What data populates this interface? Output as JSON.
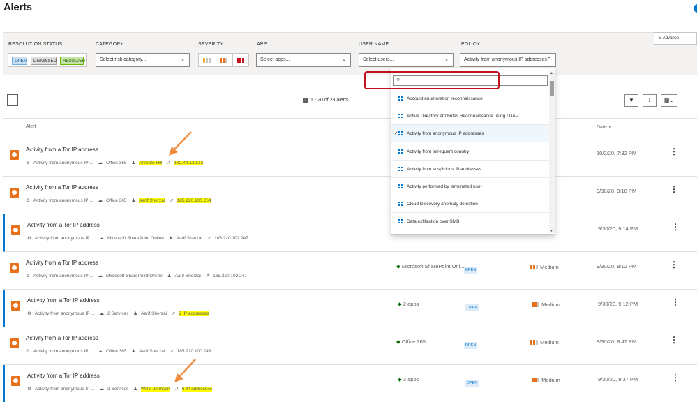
{
  "page": {
    "title": "Alerts"
  },
  "filters": {
    "resolution_status": {
      "label": "RESOLUTION STATUS",
      "chips": [
        "OPEN",
        "DISMISSED",
        "RESOLVED"
      ]
    },
    "category": {
      "label": "CATEGORY",
      "placeholder": "Select risk category..."
    },
    "severity": {
      "label": "SEVERITY"
    },
    "app": {
      "label": "APP",
      "placeholder": "Select apps..."
    },
    "user_name": {
      "label": "USER NAME",
      "placeholder": "Select users..."
    },
    "policy": {
      "label": "POLICY",
      "value": "Activity from anonymous IP addresses"
    },
    "advanced": "∨ Advance"
  },
  "toolbar": {
    "count": "1 - 20 of 28 alerts"
  },
  "table": {
    "headers": {
      "alert": "Alert",
      "date": "Date ∨"
    },
    "rows": [
      {
        "title": "Activity from a Tor IP address",
        "policy": "Activity from anonymous IP ...",
        "app": "Office 365",
        "user": "Annette Hill",
        "ip": "142.44.139.12",
        "app_col": "",
        "status": "",
        "severity": "dium",
        "date": "10/2/20, 7:32 PM"
      },
      {
        "title": "Activity from a Tor IP address",
        "policy": "Activity from anonymous IP ...",
        "app": "Office 365",
        "user": "Aarif Sherzai",
        "ip": "185.220.100.254",
        "app_col": "",
        "status": "",
        "severity": "m",
        "date": "9/30/20, 9:18 PM"
      },
      {
        "title": "Activity from a Tor IP address",
        "policy": "Activity from anonymous IP ...",
        "app": "Microsoft SharePoint Online",
        "user": "Aarif Sherzai",
        "ip": "185.220.102.247",
        "app_col": "",
        "status": "",
        "severity": "m",
        "date": "9/30/20, 9:14 PM"
      },
      {
        "title": "Activity from a Tor IP address",
        "policy": "Activity from anonymous IP ...",
        "app": "Microsoft SharePoint Online",
        "user": "Aarif Sherzai",
        "ip": "185.220.102.247",
        "app_col": "Microsoft SharePoint Onl...",
        "status": "OPEN",
        "severity": "Medium",
        "date": "9/30/20, 9:12 PM"
      },
      {
        "title": "Activity from a Tor IP address",
        "policy": "Activity from anonymous IP ...",
        "app": "2 Services",
        "user": "Aarif Sherzai",
        "ip": "2 IP addresses",
        "app_col": "2 apps",
        "status": "OPEN",
        "severity": "Medium",
        "date": "9/30/20, 9:12 PM"
      },
      {
        "title": "Activity from a Tor IP address",
        "policy": "Activity from anonymous IP ...",
        "app": "Office 365",
        "user": "Aarif Sherzai",
        "ip": "185.220.100.248",
        "app_col": "Office 365",
        "status": "OPEN",
        "severity": "Medium",
        "date": "9/30/20, 8:47 PM"
      },
      {
        "title": "Activity from a Tor IP address",
        "policy": "Activity from anonymous IP ...",
        "app": "3 Services",
        "user": "Willis Johnson",
        "ip": "6 IP addresses",
        "app_col": "3 apps",
        "status": "OPEN",
        "severity": "Medium",
        "date": "9/30/20, 8:37 PM"
      }
    ]
  },
  "policy_dropdown": {
    "search_placeholder": "",
    "items": [
      "Account enumeration reconnaissance",
      "Active Directory attributes Reconnaissance using LDAP",
      "Activity from anonymous IP addresses",
      "Activity from infrequent country",
      "Activity from suspicious IP addresses",
      "Activity performed by terminated user",
      "Cloud Discovery anomaly detection",
      "Data exfiltration over SMB"
    ],
    "selected_index": 2
  },
  "colors": {
    "accent": "#0078d4",
    "severity_orange": "#e8711c",
    "highlight": "#ffff00",
    "annotation_box": "#c50f1f",
    "arrow": "#f08a3c"
  }
}
